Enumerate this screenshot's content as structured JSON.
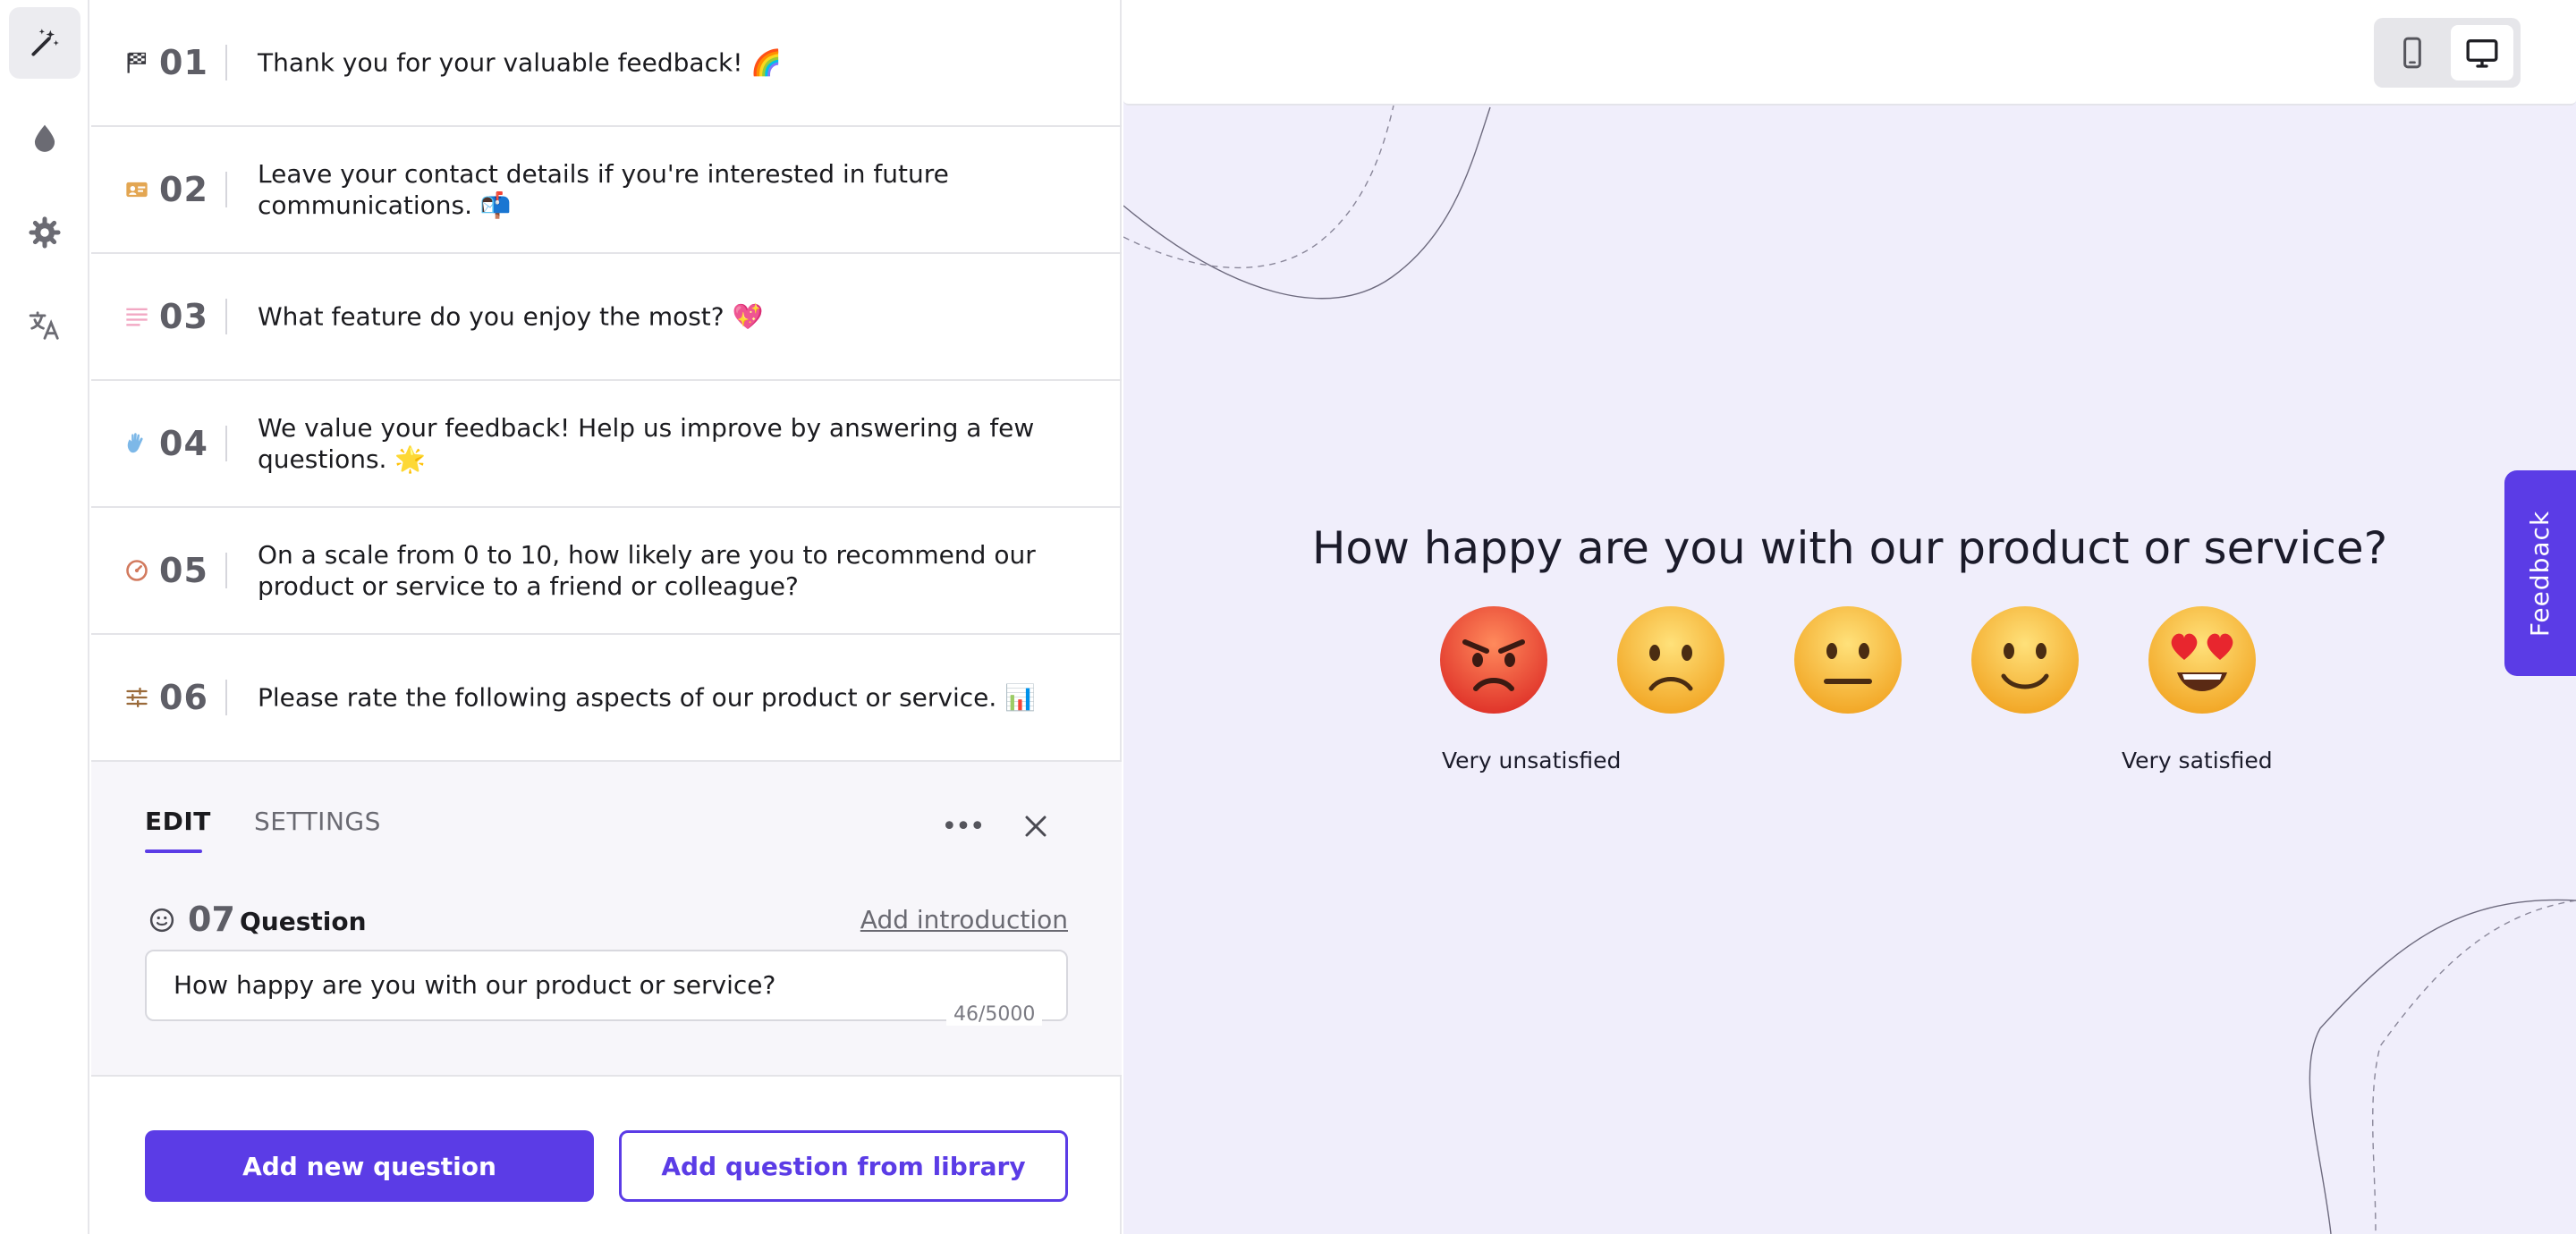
{
  "rail": {
    "items": [
      {
        "name": "magic-wand-icon",
        "active": true
      },
      {
        "name": "droplet-icon",
        "active": false
      },
      {
        "name": "gear-icon",
        "active": false
      },
      {
        "name": "translate-icon",
        "active": false
      }
    ]
  },
  "questions": [
    {
      "num": "01",
      "icon": "finish-flag-icon",
      "text": "Thank you for your valuable feedback! 🌈"
    },
    {
      "num": "02",
      "icon": "contact-card-icon",
      "text": "Leave your contact details if you're interested in future communications. 📬"
    },
    {
      "num": "03",
      "icon": "text-lines-icon",
      "text": "What feature do you enjoy the most? 💖"
    },
    {
      "num": "04",
      "icon": "waving-hand-icon",
      "text": "We value your feedback! Help us improve by answering a few questions. 🌟"
    },
    {
      "num": "05",
      "icon": "gauge-icon",
      "text": "On a scale from 0 to 10, how likely are you to recommend our product or service to a friend or colleague?"
    },
    {
      "num": "06",
      "icon": "sliders-icon",
      "text": "Please rate the following aspects of our product or service. 📊"
    }
  ],
  "edit": {
    "tab_edit": "EDIT",
    "tab_settings": "SETTINGS",
    "more_label": "•••",
    "question_num": "07",
    "question_label": "Question",
    "add_intro": "Add introduction",
    "question_value": "How happy are you with our product or service?",
    "char_count": "46/5000"
  },
  "actions": {
    "add_new": "Add new question",
    "add_library": "Add question from library"
  },
  "preview": {
    "question": "How happy are you with our product or service?",
    "scale": [
      "angry-face",
      "frowning-face",
      "neutral-face",
      "smiling-face",
      "heart-eyes-face"
    ],
    "label_low": "Very unsatisfied",
    "label_high": "Very satisfied",
    "feedback_tab": "Feedback",
    "device_mode": "desktop"
  },
  "colors": {
    "accent": "#5b3ce6",
    "preview_bg": "#f0eefb"
  }
}
